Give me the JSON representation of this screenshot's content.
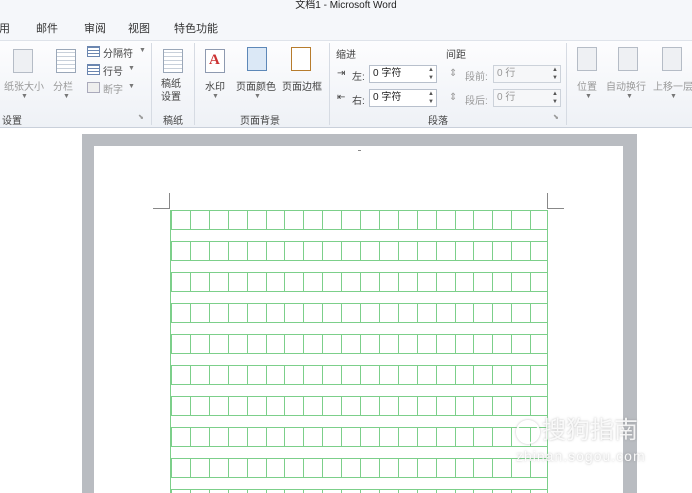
{
  "window": {
    "title": "文档1 - Microsoft Word"
  },
  "tabs": [
    "引用",
    "邮件",
    "审阅",
    "视图",
    "特色功能"
  ],
  "ribbon": {
    "page_setup": {
      "paper_size": "纸张大小",
      "columns": "分栏",
      "breaks": "分隔符",
      "line_numbers": "行号",
      "hyphenation": "断字",
      "group_label": "设置"
    },
    "manuscript": {
      "button": "稿纸设置",
      "group_label": "稿纸"
    },
    "page_background": {
      "watermark": "水印",
      "page_color": "页面颜色",
      "page_borders": "页面边框",
      "group_label": "页面背景"
    },
    "paragraph": {
      "indent_title": "缩进",
      "spacing_title": "间距",
      "indent_left_label": "左:",
      "indent_left_value": "0 字符",
      "indent_right_label": "右:",
      "indent_right_value": "0 字符",
      "spacing_before_label": "段前:",
      "spacing_before_value": "0 行",
      "spacing_after_label": "段后:",
      "spacing_after_value": "0 行",
      "group_label": "段落"
    },
    "arrange": {
      "position": "位置",
      "wrap_text": "自动换行",
      "bring_forward": "上移一层"
    }
  },
  "watermark_overlay": {
    "brand": "搜狗指南",
    "url": "zhinan.sogou.com"
  },
  "colors": {
    "grid_line": "#7ccf8a",
    "ribbon_bg": "#f5f7fa",
    "doc_frame": "#b9bcc1"
  }
}
